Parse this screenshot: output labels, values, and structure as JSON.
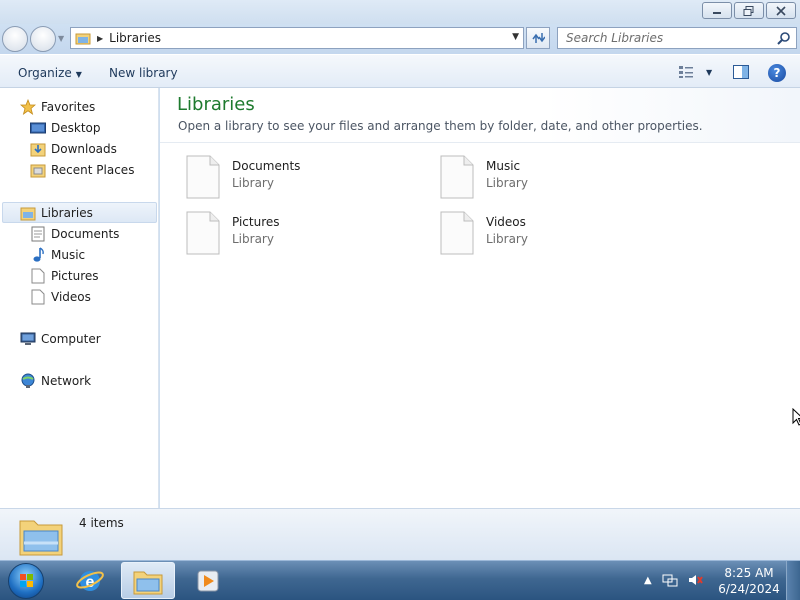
{
  "window": {
    "controls": [
      "minimize-icon",
      "restore-icon",
      "close-icon"
    ]
  },
  "address": {
    "location": "Libraries",
    "search_placeholder": "Search Libraries"
  },
  "toolbar": {
    "organize_label": "Organize",
    "new_library_label": "New library"
  },
  "nav": {
    "favorites": {
      "label": "Favorites",
      "items": [
        {
          "label": "Desktop",
          "icon": "desktop-icon"
        },
        {
          "label": "Downloads",
          "icon": "downloads-folder-icon"
        },
        {
          "label": "Recent Places",
          "icon": "recent-places-icon"
        }
      ]
    },
    "libraries": {
      "label": "Libraries",
      "items": [
        {
          "label": "Documents",
          "icon": "documents-icon"
        },
        {
          "label": "Music",
          "icon": "music-icon"
        },
        {
          "label": "Pictures",
          "icon": "pictures-icon"
        },
        {
          "label": "Videos",
          "icon": "videos-icon"
        }
      ]
    },
    "computer_label": "Computer",
    "network_label": "Network"
  },
  "content": {
    "title": "Libraries",
    "subtitle": "Open a library to see your files and arrange them by folder, date, and other properties.",
    "libraries": [
      {
        "name": "Documents",
        "type": "Library"
      },
      {
        "name": "Music",
        "type": "Library"
      },
      {
        "name": "Pictures",
        "type": "Library"
      },
      {
        "name": "Videos",
        "type": "Library"
      }
    ]
  },
  "details": {
    "count": "4 items"
  },
  "taskbar": {
    "apps": [
      "internet-explorer-icon",
      "windows-explorer-icon",
      "media-player-icon"
    ],
    "time": "8:25 AM",
    "date": "6/24/2024"
  },
  "colors": {
    "title_green": "#1e7a2e",
    "accent_blue": "#1e395b",
    "taskbar": "#3f6791"
  }
}
